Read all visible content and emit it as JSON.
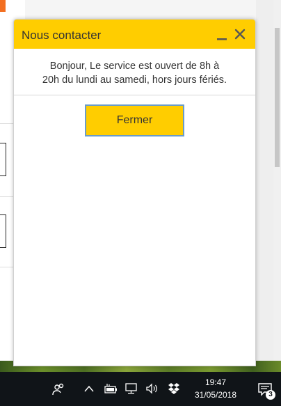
{
  "chat": {
    "title": "Nous contacter",
    "message_line1": "Bonjour, Le service est ouvert de 8h à",
    "message_line2": "20h du lundi au samedi, hors jours fériés.",
    "close_button_label": "Fermer",
    "accent_color": "#ffcd00",
    "icons": {
      "minimize": "minimize-icon",
      "close": "close-icon"
    }
  },
  "taskbar": {
    "time": "19:47",
    "date": "31/05/2018",
    "notification_count": "3",
    "icons": [
      "people-icon",
      "chevron-up-icon",
      "battery-icon",
      "network-icon",
      "volume-icon",
      "dropbox-icon",
      "notification-icon"
    ]
  }
}
